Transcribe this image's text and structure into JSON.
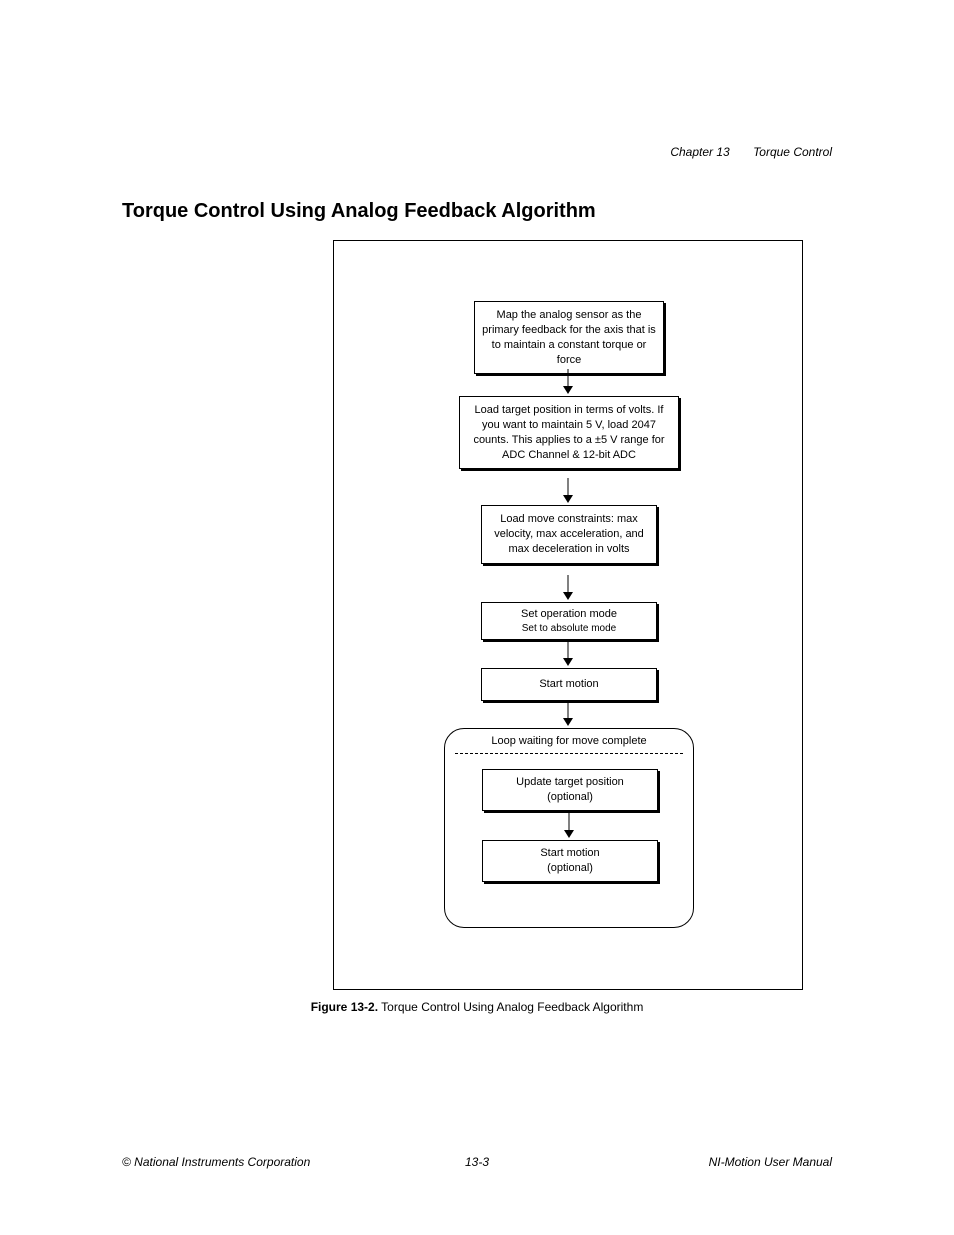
{
  "header": {
    "chapter": "Chapter 13",
    "title": "Torque Control"
  },
  "section_title": "Torque Control Using Analog Feedback Algorithm",
  "flowchart": {
    "box1": "Map the analog sensor as the primary feedback for the axis that is to maintain a constant torque or force",
    "box2": "Load target position in terms of volts. If you want to maintain 5 V, load 2047 counts. This applies to a ±5 V range for ADC Channel & 12-bit ADC",
    "box3": "Load move constraints: max velocity, max acceleration, and max deceleration in volts",
    "box4a": "Set operation mode",
    "box4b": "Set to absolute mode",
    "box5": "Start motion",
    "loop_label": "Loop waiting for move complete",
    "box6a": "Update target position",
    "box6b": "(optional)",
    "box7a": "Start motion",
    "box7b": "(optional)"
  },
  "caption": {
    "bold": "Figure 13-2.",
    "text": "  Torque Control Using Analog Feedback Algorithm"
  },
  "footer": {
    "left": "© National Instruments Corporation",
    "center": "13-3",
    "right": "NI-Motion User Manual"
  }
}
